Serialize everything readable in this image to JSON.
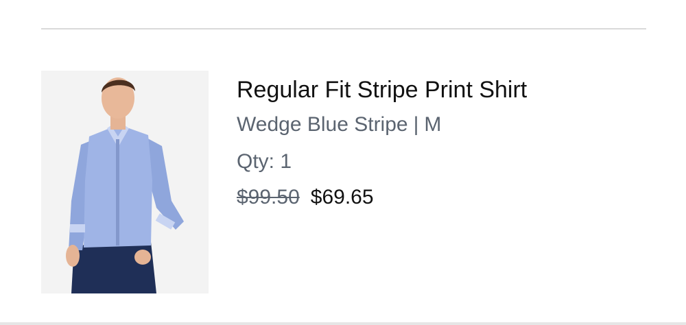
{
  "cart_item": {
    "title": "Regular Fit Stripe Print Shirt",
    "color": "Wedge Blue Stripe",
    "separator": "|",
    "size": "M",
    "quantity_label": "Qty:",
    "quantity": "1",
    "original_price": "$99.50",
    "sale_price": "$69.65",
    "image_icon": "product-photo"
  },
  "colors": {
    "title_text": "#111111",
    "secondary_text": "#5b6470",
    "divider": "#d9d9d9",
    "shirt": "#8fa6dc",
    "jeans": "#1f2f57"
  }
}
